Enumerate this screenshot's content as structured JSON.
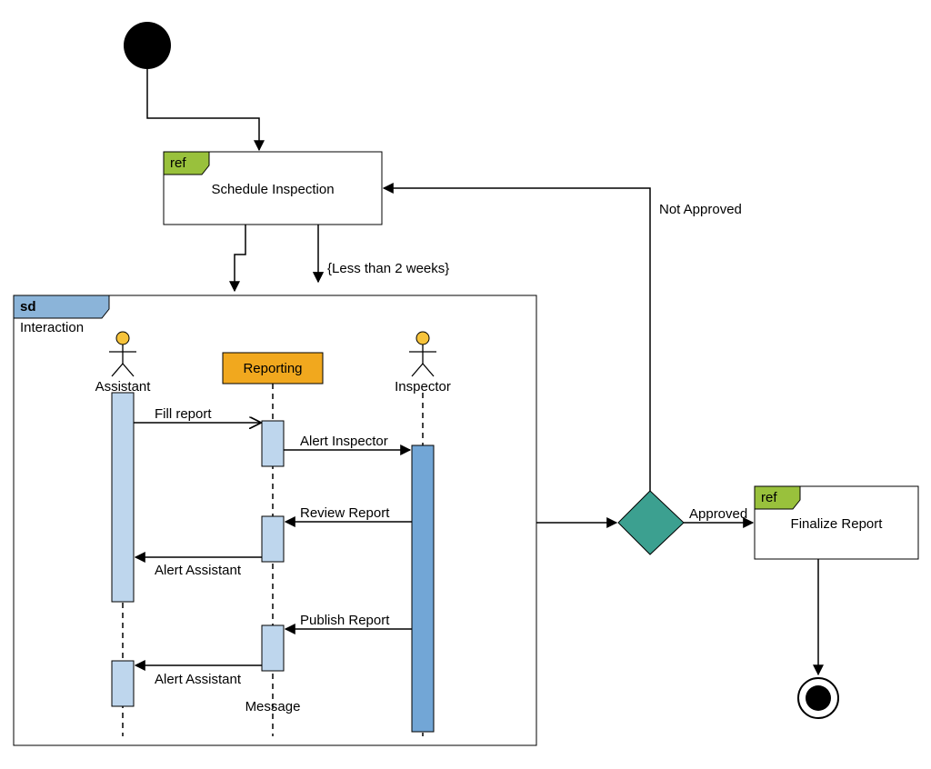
{
  "diagram": {
    "initial_node": "●",
    "schedule_frame": {
      "tag": "ref",
      "title": "Schedule Inspection"
    },
    "constraint": "{Less than 2 weeks}",
    "interaction_frame": {
      "tag": "sd",
      "title": "Interaction"
    },
    "actors": {
      "assistant": "Assistant",
      "inspector": "Inspector"
    },
    "component": {
      "reporting": "Reporting"
    },
    "messages": {
      "fill_report": "Fill report",
      "alert_inspector": "Alert Inspector",
      "review_report": "Review Report",
      "alert_assistant_1": "Alert Assistant",
      "publish_report": "Publish Report",
      "alert_assistant_2": "Alert Assistant",
      "message_label": "Message"
    },
    "decision": {
      "approved": "Approved",
      "not_approved": "Not Approved"
    },
    "finalize_frame": {
      "tag": "ref",
      "title": "Finalize Report"
    }
  }
}
